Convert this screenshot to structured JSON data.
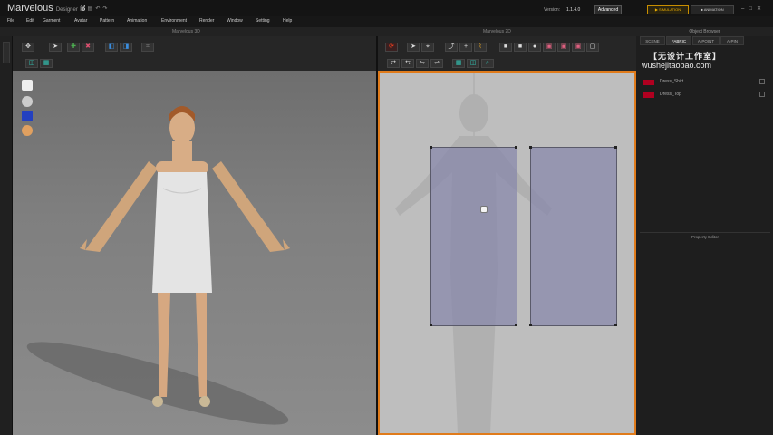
{
  "app": {
    "name": "Marvelous",
    "subtitle": "Designer",
    "version_num": "3",
    "version_label": "Version:",
    "version_value": "1.1.4.0",
    "mode_label": "Advanced",
    "simulation_label": "SIMULATION",
    "animation_label": "ANIMATION"
  },
  "menu": [
    "File",
    "Edit",
    "Garment",
    "Avatar",
    "Pattern",
    "Animation",
    "Environment",
    "Render",
    "Window",
    "Setting",
    "Help"
  ],
  "panels": {
    "left_title": "Marvelous 3D",
    "center_title": "Marvelous 2D",
    "object_browser": "Object Browser",
    "property_editor": "Property Editor"
  },
  "right_tabs": [
    "SCENE",
    "FABRIC",
    "A-POINT",
    "A-PIN"
  ],
  "watermark": {
    "line1": "【无设计工作室】",
    "line2": "wushejitaobao.com"
  },
  "fabrics": [
    {
      "name": "Dress_Shirt",
      "color": "#b00020"
    },
    {
      "name": "Dress_Top",
      "color": "#b00020"
    }
  ],
  "colors": {
    "accent_orange": "#e07b1b",
    "sim_gold": "#f0b000",
    "viewport_2d_bg": "#bebebe",
    "pattern_fill": "#8787aa"
  }
}
